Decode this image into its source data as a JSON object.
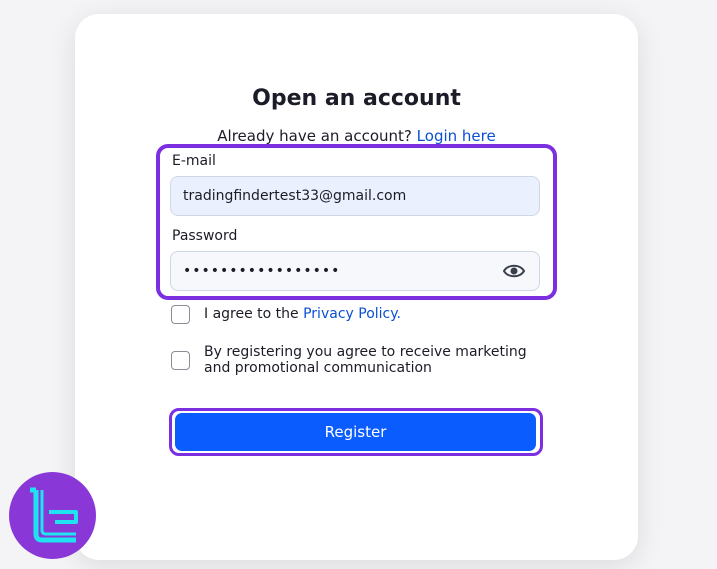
{
  "form": {
    "title": "Open an account",
    "have_account_text": "Already have an account?",
    "login_link": "Login here",
    "email_label": "E-mail",
    "email_value": "tradingfindertest33@gmail.com",
    "password_label": "Password",
    "password_value": "•••••••••••••••••",
    "password_toggle_icon": "eye-icon",
    "privacy_prefix": "I agree to the",
    "privacy_link": "Privacy Policy.",
    "marketing_line1": "By registering you agree to receive marketing",
    "marketing_line2": "and promotional communication",
    "register_label": "Register"
  },
  "colors": {
    "accent_blue": "#0a5cff",
    "link_blue": "#0a4fd6",
    "highlight_purple": "#7b2fe0",
    "logo_purple": "#8a37d8",
    "logo_cyan": "#1fe3f0"
  }
}
